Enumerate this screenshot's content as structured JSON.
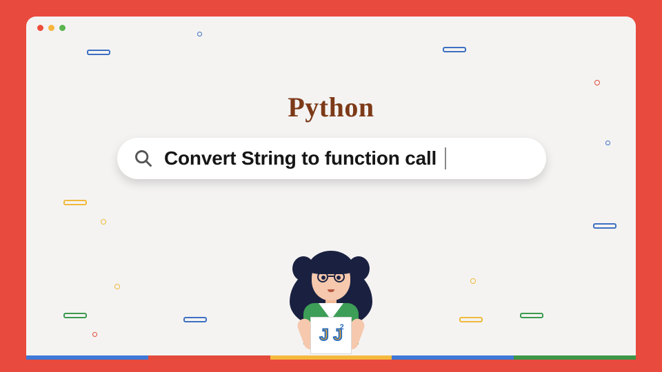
{
  "title": "Python",
  "search": {
    "query": "Convert String to function call"
  },
  "logo": {
    "main": "J J",
    "sup": "2"
  },
  "colors": {
    "background": "#e84a3e",
    "window": "#f4f3f2",
    "title": "#7d3a18",
    "stripe": [
      "#3f78d6",
      "#e34a3b",
      "#f4b93d",
      "#3c9648"
    ]
  }
}
